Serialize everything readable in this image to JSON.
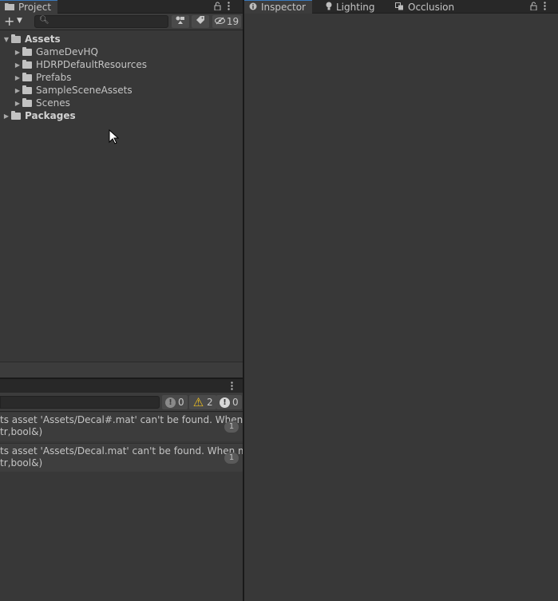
{
  "project": {
    "tab_label": "Project",
    "hidden_count": "19",
    "search": {
      "placeholder": "",
      "value": ""
    },
    "tree": [
      {
        "label": "Assets",
        "expanded": true,
        "bold": true
      },
      {
        "label": "GameDevHQ"
      },
      {
        "label": "HDRPDefaultResources"
      },
      {
        "label": "Prefabs"
      },
      {
        "label": "SampleSceneAssets"
      },
      {
        "label": "Scenes"
      },
      {
        "label": "Packages",
        "bold": true
      }
    ]
  },
  "console": {
    "info_count": "0",
    "warning_count": "2",
    "error_count": "0",
    "entries": [
      {
        "line1": "ts asset 'Assets/Decal#.mat' can't be found. When moving",
        "line2": "tr,bool&)",
        "count": "1"
      },
      {
        "line1": "ts asset 'Assets/Decal.mat' can't be found. When moving",
        "line2": "tr,bool&)",
        "count": "1"
      }
    ]
  },
  "inspector": {
    "tabs": [
      {
        "label": "Inspector",
        "icon": "info-icon"
      },
      {
        "label": "Lighting",
        "icon": "bulb-icon"
      },
      {
        "label": "Occlusion",
        "icon": "occlusion-icon"
      }
    ]
  },
  "colors": {
    "background": "#383838",
    "tabbar": "#282828",
    "toolbar": "#3c3c3c",
    "text": "#c4c4c4",
    "accent": "#3a79bb",
    "warning": "#f0c020"
  }
}
